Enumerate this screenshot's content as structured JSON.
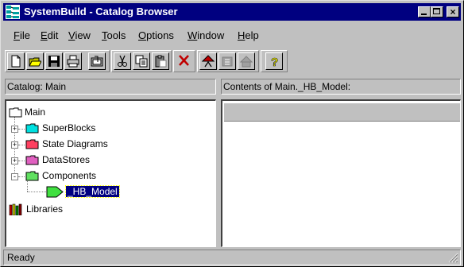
{
  "window": {
    "title": "SystemBuild - Catalog Browser",
    "controls": [
      "minimize",
      "maximize",
      "close"
    ]
  },
  "menubar": {
    "items": [
      {
        "label": "File",
        "accel": "F"
      },
      {
        "label": "Edit",
        "accel": "E"
      },
      {
        "label": "View",
        "accel": "V"
      },
      {
        "label": "Tools",
        "accel": "T"
      },
      {
        "label": "Options",
        "accel": "O"
      },
      {
        "label": "Window",
        "accel": "W"
      },
      {
        "label": "Help",
        "accel": "H"
      }
    ]
  },
  "toolbar": {
    "buttons": [
      "new-icon",
      "open-icon",
      "save-icon",
      "print-icon",
      "import-icon",
      "cut-icon",
      "copy-icon",
      "paste-icon",
      "delete-icon",
      "hierarchy-icon",
      "hierarchy-disabled-icon",
      "home-disabled-icon",
      "help-icon"
    ]
  },
  "catalog_pane": {
    "header": "Catalog: Main",
    "tree": [
      {
        "label": "Main",
        "level": 0,
        "icon": "open-folder-icon"
      },
      {
        "label": "SuperBlocks",
        "level": 1,
        "icon": "cyan-folder-icon",
        "expander": "+"
      },
      {
        "label": "State Diagrams",
        "level": 1,
        "icon": "red-folder-icon",
        "expander": "+"
      },
      {
        "label": "DataStores",
        "level": 1,
        "icon": "magenta-folder-icon",
        "expander": "+"
      },
      {
        "label": "Components",
        "level": 1,
        "icon": "green-folder-icon",
        "expander": "-"
      },
      {
        "label": "_HB_Model",
        "level": 2,
        "icon": "green-arrow-icon",
        "selected": true
      },
      {
        "label": "Libraries",
        "level": 0,
        "icon": "books-icon"
      }
    ]
  },
  "contents_pane": {
    "header": "Contents of Main._HB_Model:"
  },
  "status": {
    "text": "Ready"
  },
  "colors": {
    "titlebar": "#000080",
    "face": "#c0c0c0",
    "selection": "#000080"
  }
}
